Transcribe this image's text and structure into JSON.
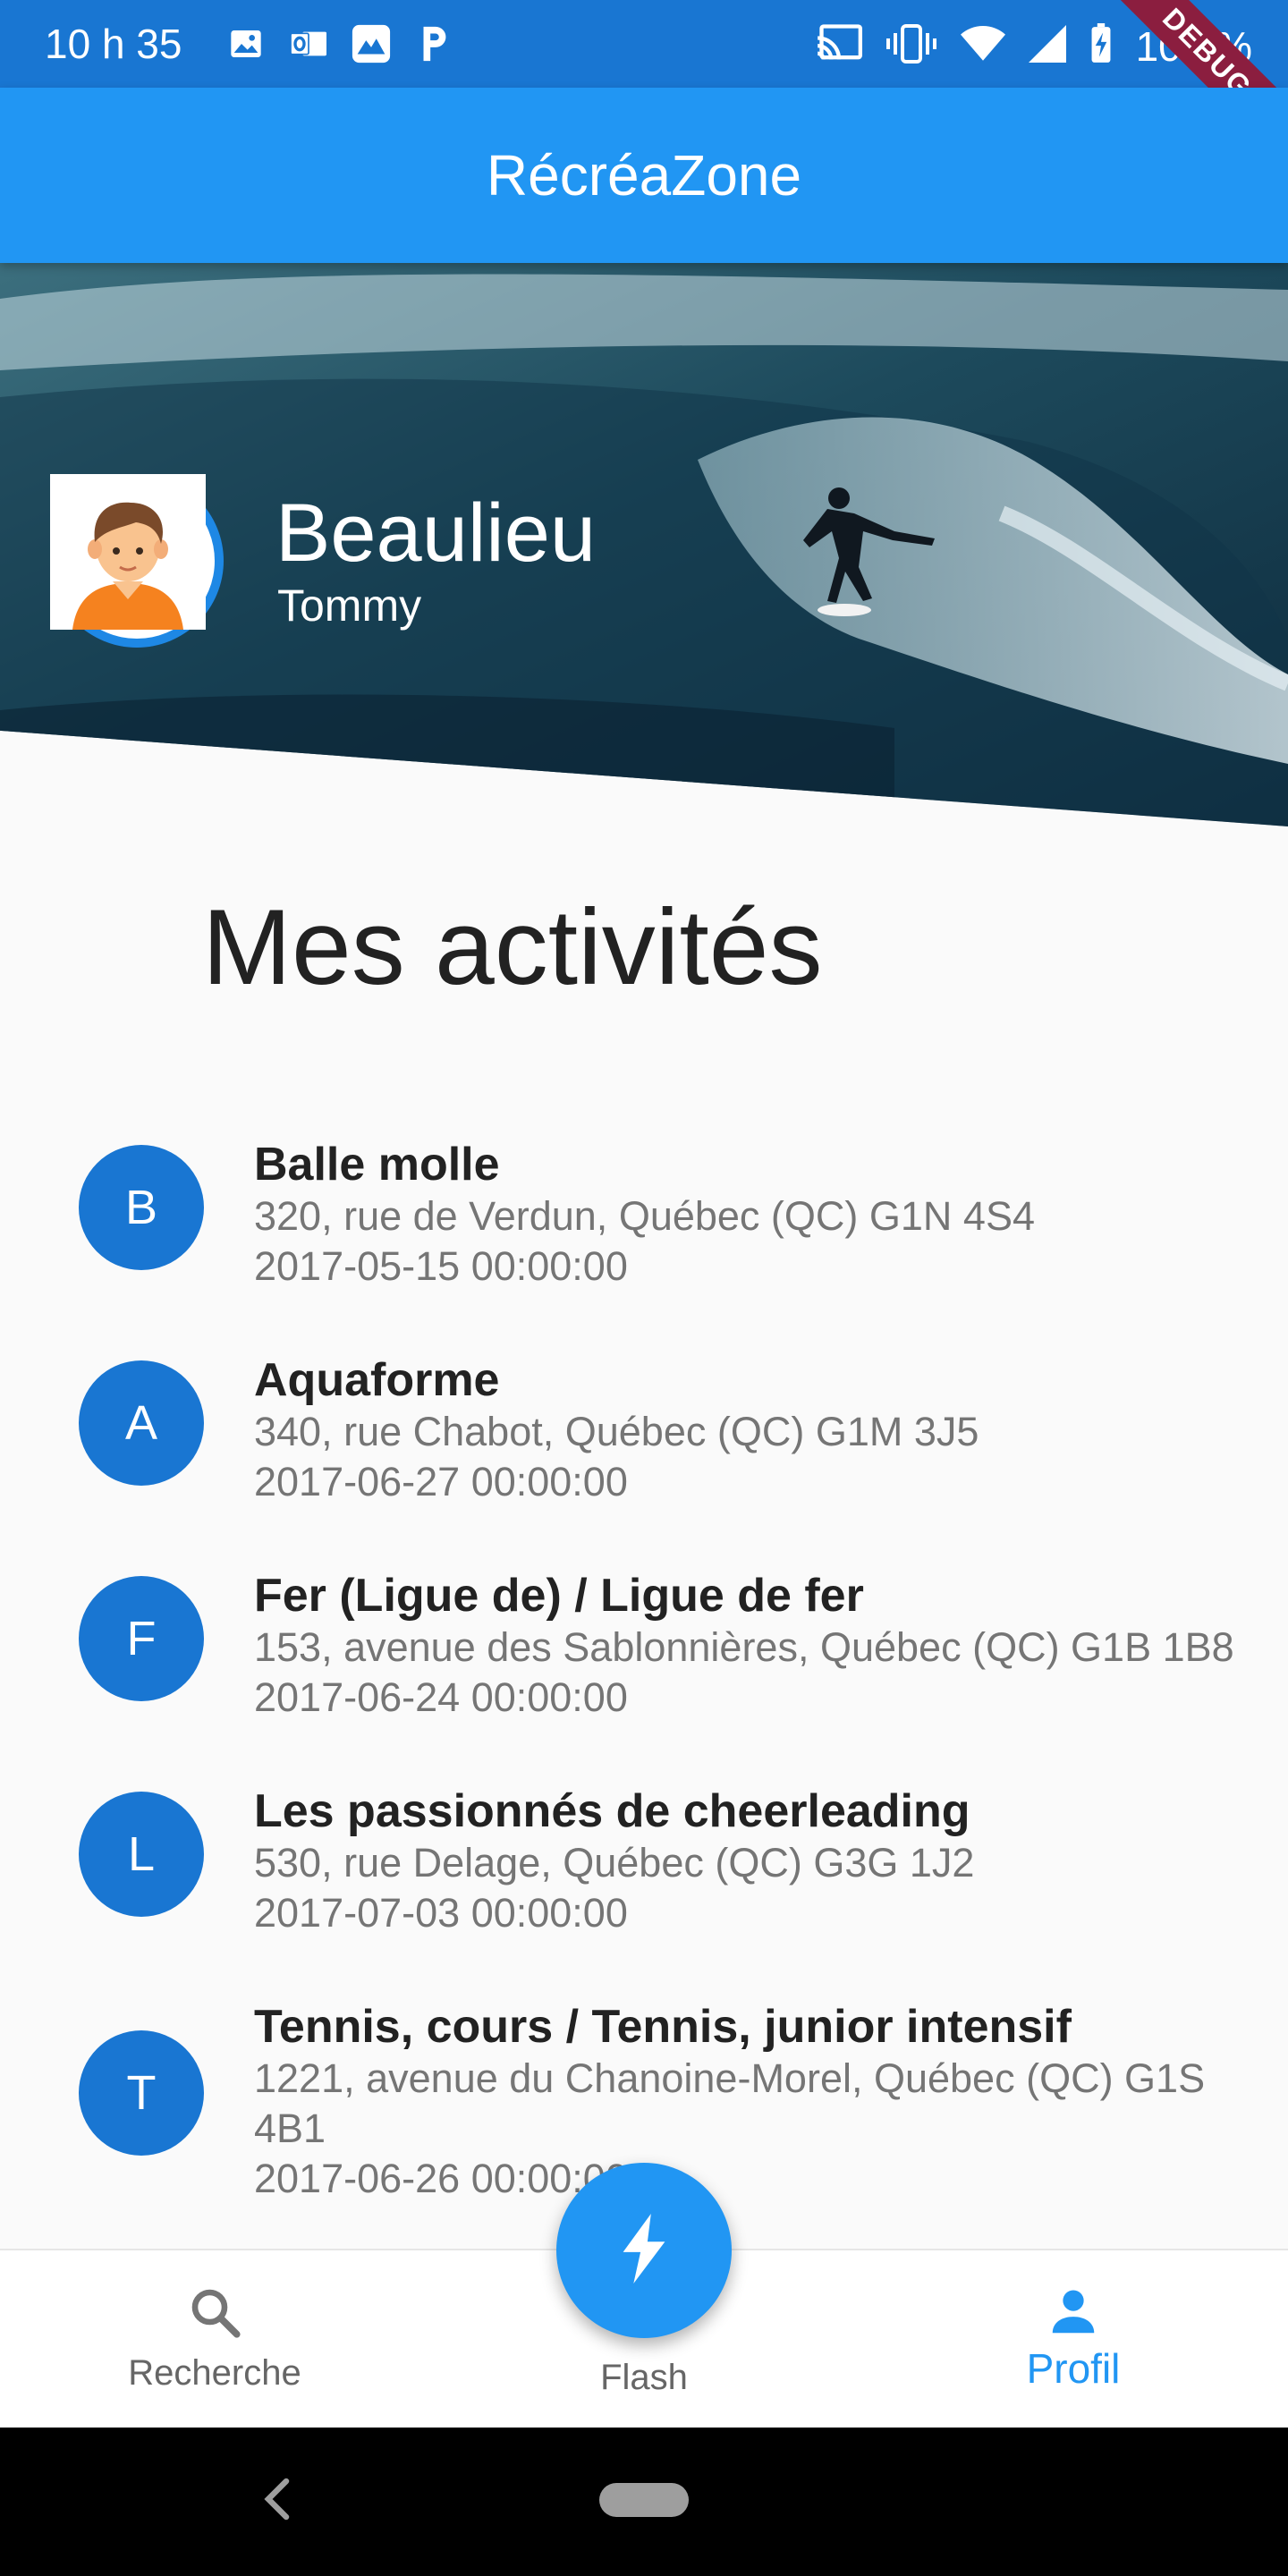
{
  "status_bar": {
    "time": "10 h 35",
    "battery": "100 %",
    "left_icons": [
      "image-icon",
      "outlook-icon",
      "mountain-app-icon",
      "parking-icon"
    ],
    "right_icons": [
      "cast-icon",
      "vibrate-icon",
      "wifi-icon",
      "signal-icon",
      "battery-charging-icon"
    ]
  },
  "debug_banner": "DEBUG",
  "app_bar": {
    "title": "RécréaZone"
  },
  "profile": {
    "last_name": "Beaulieu",
    "first_name": "Tommy"
  },
  "section_title": "Mes activités",
  "activities": [
    {
      "initial": "B",
      "title": "Balle molle",
      "address": "320, rue de Verdun, Québec (QC) G1N 4S4",
      "date": "2017-05-15 00:00:00"
    },
    {
      "initial": "A",
      "title": "Aquaforme",
      "address": "340, rue Chabot, Québec (QC) G1M 3J5",
      "date": "2017-06-27 00:00:00"
    },
    {
      "initial": "F",
      "title": "Fer (Ligue de) / Ligue de fer",
      "address": "153, avenue des Sablonnières, Québec (QC) G1B 1B8",
      "date": "2017-06-24 00:00:00"
    },
    {
      "initial": "L",
      "title": "Les passionnés de cheerleading",
      "address": "530, rue Delage, Québec (QC) G3G 1J2",
      "date": "2017-07-03 00:00:00"
    },
    {
      "initial": "T",
      "title": "Tennis, cours / Tennis, junior intensif",
      "address": "1221, avenue du Chanoine-Morel, Québec (QC) G1S 4B1",
      "date": "2017-06-26 00:00:00"
    }
  ],
  "bottom_nav": {
    "items": [
      {
        "label": "Recherche",
        "icon": "search-icon",
        "active": false
      },
      {
        "label": "Flash",
        "icon": "flash-icon",
        "active": false
      },
      {
        "label": "Profil",
        "icon": "person-icon",
        "active": true
      }
    ]
  },
  "colors": {
    "status_bar": "#1976d2",
    "app_bar": "#2196f3",
    "accent": "#2196f3",
    "avatar": "#1976d2",
    "debug": "#8b1e3f"
  }
}
